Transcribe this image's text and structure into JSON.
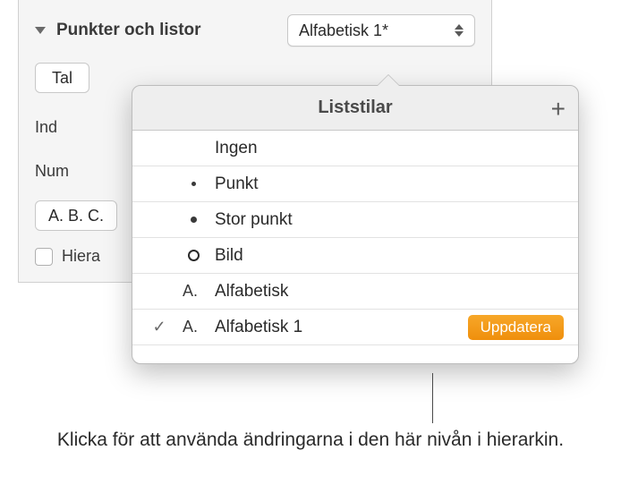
{
  "section": {
    "title": "Punkter och listor",
    "selected_style": "Alfabetisk 1*",
    "tal_label": "Tal",
    "ind_label": "Ind",
    "num_label": "Num",
    "format_label": "A. B. C.",
    "hiera_label": "Hiera"
  },
  "popover": {
    "title": "Liststilar",
    "update_label": "Uppdatera",
    "items": [
      {
        "check": false,
        "marker": "",
        "label": "Ingen"
      },
      {
        "check": false,
        "marker": "small",
        "label": "Punkt"
      },
      {
        "check": false,
        "marker": "big",
        "label": "Stor punkt"
      },
      {
        "check": false,
        "marker": "ring",
        "label": "Bild"
      },
      {
        "check": false,
        "marker": "A.",
        "label": "Alfabetisk"
      },
      {
        "check": true,
        "marker": "A.",
        "label": "Alfabetisk 1",
        "update": true
      }
    ]
  },
  "callout": {
    "text": "Klicka för att använda ändringarna i den här nivån i hierarkin."
  }
}
